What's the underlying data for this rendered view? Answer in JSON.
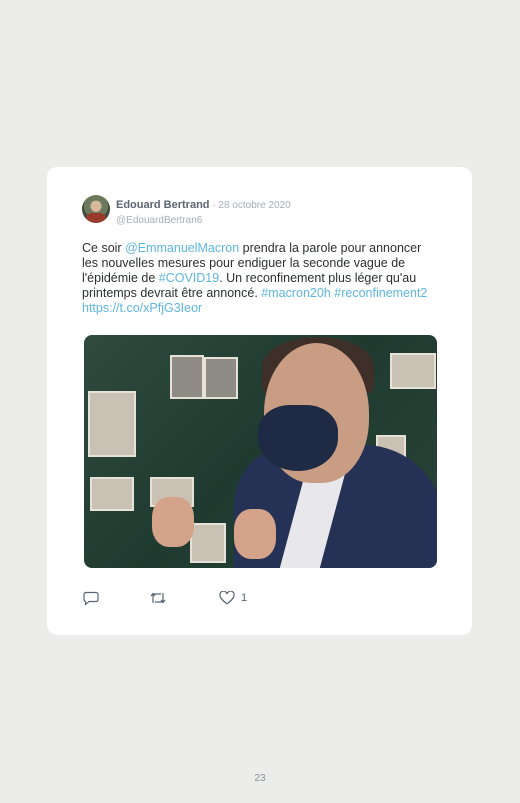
{
  "tweet": {
    "author_name": "Edouard Bertrand",
    "separator": " · ",
    "date": "28 octobre 2020",
    "handle": "@EdouardBertran6",
    "text_parts": [
      {
        "text": "Ce soir ",
        "type": "text"
      },
      {
        "text": "@EmmanuelMacron",
        "type": "link"
      },
      {
        "text": " prendra la parole pour annoncer les nouvelles mesures pour endiguer la seconde vague de l'épidémie de ",
        "type": "text"
      },
      {
        "text": "#COVID19",
        "type": "link"
      },
      {
        "text": ". Un reconfinement plus léger qu'au printemps devrait être annoncé. ",
        "type": "text"
      },
      {
        "text": "#macron20h",
        "type": "link"
      },
      {
        "text": " ",
        "type": "text"
      },
      {
        "text": "#reconfinement2",
        "type": "link"
      },
      {
        "text": " ",
        "type": "text"
      },
      {
        "text": "https://t.co/xPfjG3Ieor",
        "type": "link"
      }
    ],
    "like_count": "1"
  },
  "icons": {
    "reply": "reply-icon",
    "retweet": "retweet-icon",
    "like": "heart-icon"
  },
  "colors": {
    "page_background": "#ececeb",
    "card_background": "#ffffff",
    "link": "#5db6e2",
    "text": "#2d2f33",
    "muted": "#a6adb8"
  },
  "page_number": "23"
}
